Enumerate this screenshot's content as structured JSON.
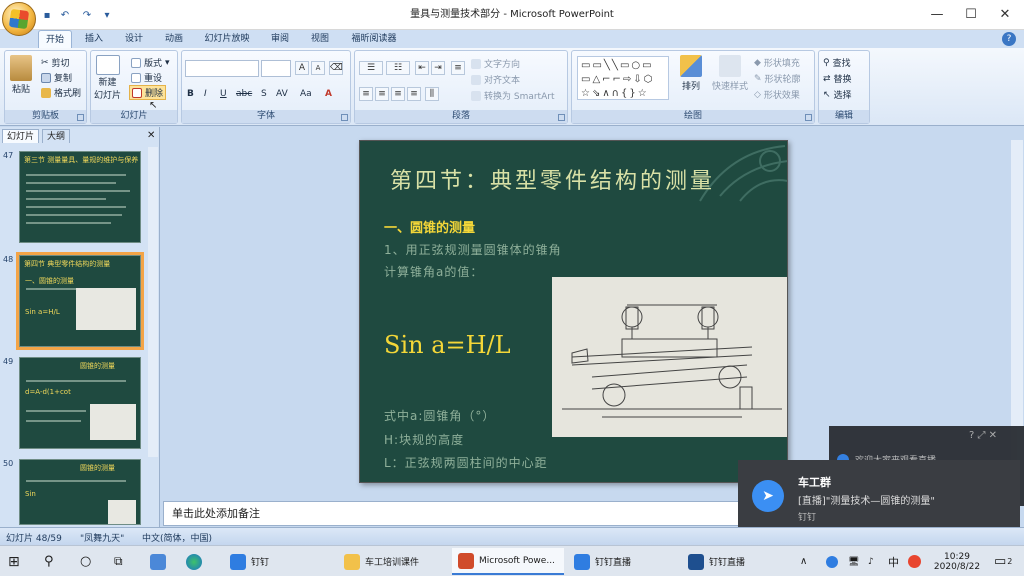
{
  "window": {
    "title": "量具与测量技术部分 - Microsoft PowerPoint"
  },
  "ribbon_tabs": [
    "开始",
    "插入",
    "设计",
    "动画",
    "幻灯片放映",
    "审阅",
    "视图",
    "福昕阅读器"
  ],
  "clipboard": {
    "paste": "粘贴",
    "cut": "剪切",
    "copy": "复制",
    "format_painter": "格式刷",
    "label": "剪贴板"
  },
  "slides_group": {
    "new_slide_1": "新建",
    "new_slide_2": "幻灯片",
    "layout": "版式",
    "reset": "重设",
    "delete": "删除",
    "label": "幻灯片"
  },
  "font_group": {
    "label": "字体",
    "grow": "A",
    "shrink": "A",
    "bold": "B",
    "italic": "I",
    "underline": "U",
    "strike": "abc",
    "shadow": "S",
    "spacing": "AV",
    "case": "Aa",
    "color": "A"
  },
  "paragraph_group": {
    "label": "段落",
    "text_direction": "文字方向",
    "align_text": "对齐文本",
    "smartart": "转换为 SmartArt"
  },
  "drawing_group": {
    "label": "绘图",
    "arrange": "排列",
    "quick_styles": "快速样式",
    "fill": "形状填充",
    "outline": "形状轮廓",
    "effects": "形状效果"
  },
  "editing_group": {
    "label": "编辑",
    "find": "查找",
    "replace": "替换",
    "select": "选择"
  },
  "left_pane": {
    "tab_slides": "幻灯片",
    "tab_outline": "大纲",
    "thumbs": [
      {
        "num": "47",
        "title": "第三节 测量量具、量规的维护与保养"
      },
      {
        "num": "48",
        "title": "第四节 典型零件结构的测量",
        "sub": "一、圆锥的测量",
        "formula": "Sin a=H/L"
      },
      {
        "num": "49",
        "title": "圆锥的测量",
        "formula": "d=A-d(1+cot"
      },
      {
        "num": "50",
        "title": "圆锥的测量",
        "formula": "Sin"
      }
    ]
  },
  "slide": {
    "title": "第四节：典型零件结构的测量",
    "section": "一、圆锥的测量",
    "line1": "1、用正弦规测量圆锥体的锥角",
    "line2": "计算锥角a的值：",
    "formula": "Sin a=H/L",
    "line3": "式中a:圆锥角（°）",
    "line4": "H:块规的高度",
    "line5": "L：正弦规两圆柱间的中心距"
  },
  "notes_placeholder": "单击此处添加备注",
  "statusbar": {
    "slide_pos": "幻灯片 48/59",
    "theme": "\"凤舞九天\"",
    "language": "中文(简体，中国)"
  },
  "notification_back": {
    "text": "欢迎大家来观看直播"
  },
  "notification": {
    "title": "车工群",
    "body": "[直播]\"测量技术—圆锥的测量\"",
    "app": "钉钉"
  },
  "taskbar": {
    "items": [
      "钉钉",
      "车工培训课件",
      "Microsoft Powe...",
      "钉钉直播",
      "钉钉直播"
    ],
    "tray_ime": "中",
    "time": "10:29",
    "date": "2020/8/22",
    "badge": "2"
  },
  "colors": {
    "slide_bg": "#1f4a40",
    "accent_yellow": "#f4d738",
    "ribbon": "#dbe7f6"
  }
}
